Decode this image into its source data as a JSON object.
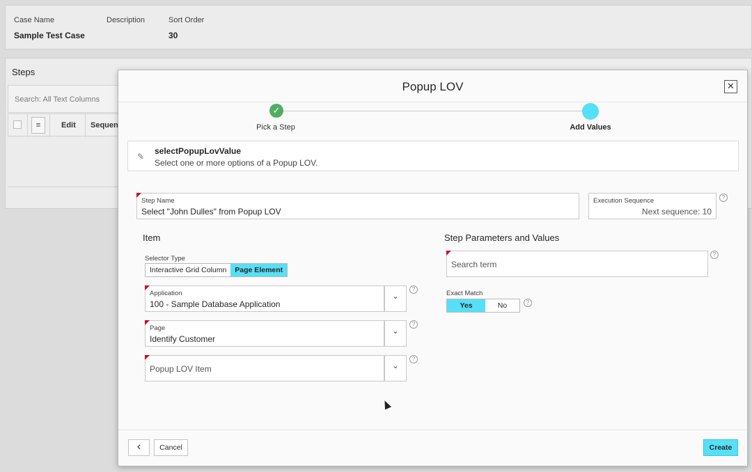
{
  "background": {
    "case_name_label": "Case Name",
    "case_name_value": "Sample Test Case",
    "description_label": "Description",
    "sort_order_label": "Sort Order",
    "sort_order_value": "30",
    "steps_title": "Steps",
    "search_placeholder": "Search: All Text Columns",
    "col_edit": "Edit",
    "col_sequence": "Sequence"
  },
  "dialog": {
    "title": "Popup LOV",
    "close_glyph": "✕",
    "wizard": {
      "step1": "Pick a Step",
      "step2": "Add Values",
      "check_glyph": "✓"
    },
    "info": {
      "icon_glyph": "✎",
      "title": "selectPopupLovValue",
      "description": "Select one or more options of a Popup LOV."
    },
    "step_name": {
      "label": "Step Name",
      "value": "Select \"John Dulles\" from Popup LOV"
    },
    "execution_sequence": {
      "label": "Execution Sequence",
      "placeholder": "Next sequence: 10"
    },
    "item_section": {
      "title": "Item",
      "selector_type_label": "Selector Type",
      "selector_options": [
        "Interactive Grid Column",
        "Page Element"
      ],
      "selector_selected": "Page Element",
      "application_label": "Application",
      "application_value": "100 - Sample Database Application",
      "page_label": "Page",
      "page_value": "Identify Customer",
      "popup_lov_item_placeholder": "Popup LOV Item",
      "chevron_glyph": "⌄"
    },
    "params_section": {
      "title": "Step Parameters and Values",
      "search_term_placeholder": "Search term",
      "exact_match_label": "Exact Match",
      "exact_match_options": [
        "Yes",
        "No"
      ],
      "exact_match_selected": "Yes"
    },
    "help_glyph": "?",
    "footer": {
      "back_glyph": "‹",
      "cancel_label": "Cancel",
      "create_label": "Create"
    }
  },
  "colors": {
    "accent": "#56e0f7",
    "success": "#4fae62",
    "required": "#d0021b"
  }
}
